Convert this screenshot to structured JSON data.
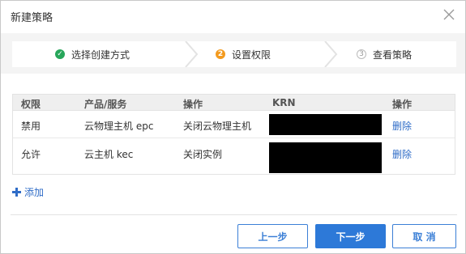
{
  "dialog": {
    "title": "新建策略"
  },
  "steps": [
    {
      "label": "选择创建方式",
      "marker": "✓",
      "state": "done"
    },
    {
      "label": "设置权限",
      "marker": "2",
      "state": "active"
    },
    {
      "label": "查看策略",
      "marker": "3",
      "state": "todo"
    }
  ],
  "table": {
    "headers": [
      "权限",
      "产品/服务",
      "操作",
      "KRN",
      "操作"
    ],
    "rows": [
      {
        "permission": "禁用",
        "product": "云物理主机 epc",
        "operation": "关闭云物理主机",
        "action": "删除"
      },
      {
        "permission": "允许",
        "product": "云主机 kec",
        "operation": "关闭实例",
        "action": "删除"
      }
    ]
  },
  "add_label": "添加",
  "footer": {
    "prev": "上一步",
    "next": "下一步",
    "cancel": "取 消"
  },
  "colors": {
    "accent": "#2d79d8",
    "done": "#27a65a",
    "active": "#f39a1e"
  }
}
